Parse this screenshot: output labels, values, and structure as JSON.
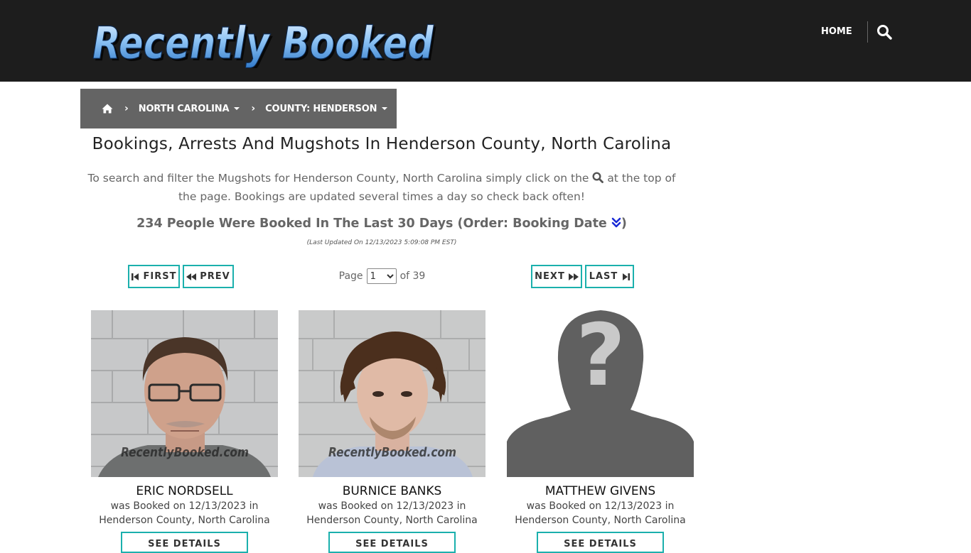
{
  "header": {
    "logo_text": "Recently Booked",
    "nav_home": "HOME",
    "search_icon": "search-icon"
  },
  "breadcrumb": {
    "home_icon": "home-icon",
    "state": "NORTH CAROLINA",
    "county": "COUNTY: HENDERSON"
  },
  "main": {
    "title": "Bookings, Arrests And Mugshots In Henderson County, North Carolina",
    "intro_before": "To search and filter the Mugshots for Henderson County, North Carolina simply click on the",
    "intro_after": "at the top of the page. Bookings are updated several times a day so check back often!",
    "count_text": "234 People Were Booked In The Last 30 Days (Order: Booking Date",
    "count_close": ")",
    "last_updated": "(Last Updated On 12/13/2023 5:09:08 PM EST)"
  },
  "pagination": {
    "first_label": "FIRST",
    "prev_label": "PREV",
    "next_label": "NEXT",
    "last_label": "LAST",
    "page_label": "Page",
    "current_page": "1",
    "of_label": "of 39"
  },
  "records": [
    {
      "name": "ERIC NORDSELL",
      "line1": "was Booked on 12/13/2023 in",
      "line2": "Henderson County, North Carolina",
      "watermark": "RecentlyBooked.com",
      "button": "SEE DETAILS"
    },
    {
      "name": "BURNICE BANKS",
      "line1": "was Booked on 12/13/2023 in",
      "line2": "Henderson County, North Carolina",
      "watermark": "RecentlyBooked.com",
      "button": "SEE DETAILS"
    },
    {
      "name": "MATTHEW GIVENS",
      "line1": "was Booked on 12/13/2023 in",
      "line2": "Henderson County, North Carolina",
      "button": "SEE DETAILS"
    }
  ],
  "colors": {
    "header_bg": "#1d1d1d",
    "breadcrumb_bg": "#646464",
    "accent_teal": "#1bb0ad",
    "sort_icon_blue": "#1a2bd6"
  }
}
